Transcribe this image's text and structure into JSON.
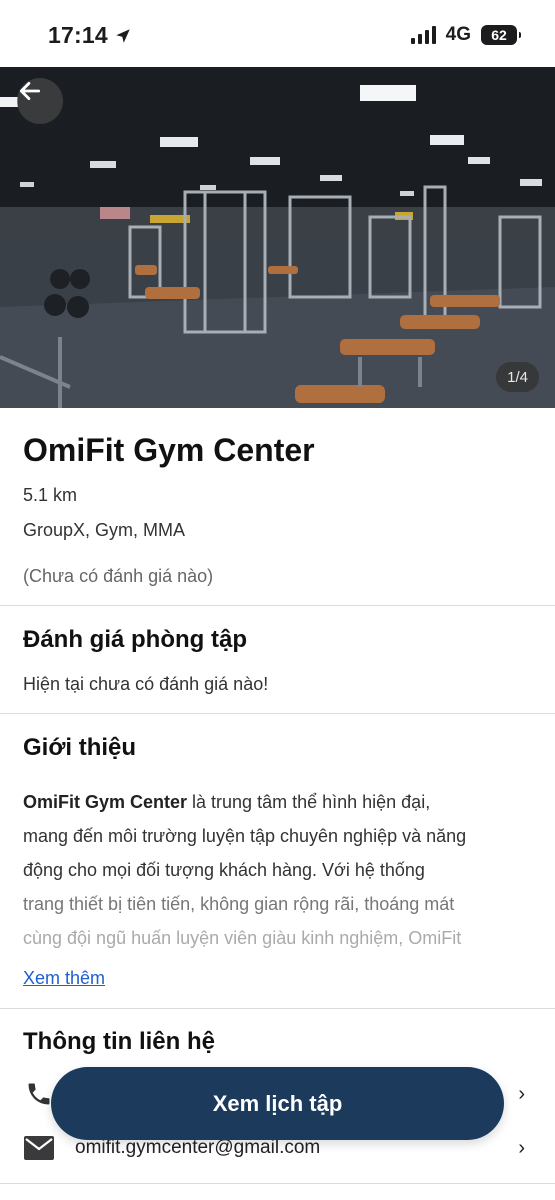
{
  "status_bar": {
    "time": "17:14",
    "network": "4G",
    "battery": "62"
  },
  "hero": {
    "counter": "1/4",
    "icons": {
      "back": "arrow-left-icon",
      "location": "location-arrow-icon"
    }
  },
  "gym": {
    "name": "OmiFit Gym Center",
    "distance": "5.1 km",
    "categories": "GroupX, Gym, MMA",
    "rating_text": "(Chưa có đánh giá nào)"
  },
  "reviews": {
    "title": "Đánh giá phòng tập",
    "empty_text": "Hiện tại chưa có đánh giá nào!"
  },
  "intro": {
    "title": "Giới thiệu",
    "bold_lead": "OmiFit Gym Center",
    "line1_rest": " là trung tâm thể hình hiện đại,",
    "line2": "mang đến môi trường luyện tập chuyên nghiệp và năng",
    "line3": "động cho mọi đối tượng khách hàng. Với hệ thống",
    "line4": "trang thiết bị tiên tiến, không gian rộng rãi, thoáng mát",
    "line5": "cùng đội ngũ huấn luyện viên giàu kinh nghiệm, OmiFit",
    "see_more": "Xem thêm"
  },
  "contact": {
    "title": "Thông tin liên hệ",
    "email": "omifit.gymcenter@gmail.com",
    "icons": {
      "phone": "phone-icon",
      "email": "email-icon",
      "chevron": "chevron-right-icon"
    }
  },
  "cta": {
    "label": "Xem lịch tập"
  },
  "colors": {
    "cta_bg": "#1b3a5c",
    "link": "#1f5fd1",
    "divider": "#dcdcdc"
  }
}
